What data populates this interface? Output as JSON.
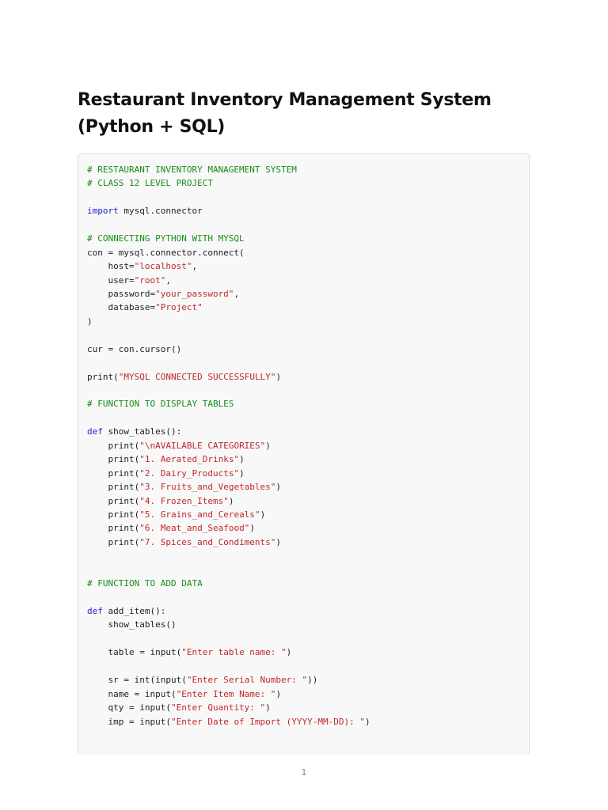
{
  "document": {
    "title_line1": "Restaurant Inventory Management System",
    "title_line2": "(Python + SQL)",
    "page_number": "1"
  },
  "colors": {
    "comment": "#1a8c1a",
    "keyword": "#2222dd",
    "string": "#c0282a",
    "plain": "#222222"
  },
  "code_lines": [
    [
      {
        "t": "cm",
        "v": "# RESTAURANT INVENTORY MANAGEMENT SYSTEM"
      }
    ],
    [
      {
        "t": "cm",
        "v": "# CLASS 12 LEVEL PROJECT"
      }
    ],
    [],
    [
      {
        "t": "kw",
        "v": "import"
      },
      {
        "t": "pl",
        "v": " mysql.connector"
      }
    ],
    [],
    [
      {
        "t": "cm",
        "v": "# CONNECTING PYTHON WITH MYSQL"
      }
    ],
    [
      {
        "t": "pl",
        "v": "con = mysql.connector.connect("
      }
    ],
    [
      {
        "t": "pl",
        "v": "    host="
      },
      {
        "t": "st",
        "v": "\"localhost\""
      },
      {
        "t": "pl",
        "v": ","
      }
    ],
    [
      {
        "t": "pl",
        "v": "    user="
      },
      {
        "t": "st",
        "v": "\"root\""
      },
      {
        "t": "pl",
        "v": ","
      }
    ],
    [
      {
        "t": "pl",
        "v": "    password="
      },
      {
        "t": "st",
        "v": "\"your_password\""
      },
      {
        "t": "pl",
        "v": ","
      }
    ],
    [
      {
        "t": "pl",
        "v": "    database="
      },
      {
        "t": "st",
        "v": "\"Project\""
      }
    ],
    [
      {
        "t": "pl",
        "v": ")"
      }
    ],
    [],
    [
      {
        "t": "pl",
        "v": "cur = con.cursor()"
      }
    ],
    [],
    [
      {
        "t": "pl",
        "v": "print("
      },
      {
        "t": "st",
        "v": "\"MYSQL CONNECTED SUCCESSFULLY\""
      },
      {
        "t": "pl",
        "v": ")"
      }
    ],
    [],
    [
      {
        "t": "cm",
        "v": "# FUNCTION TO DISPLAY TABLES"
      }
    ],
    [],
    [
      {
        "t": "kw",
        "v": "def"
      },
      {
        "t": "pl",
        "v": " show_tables():"
      }
    ],
    [
      {
        "t": "pl",
        "v": "    print("
      },
      {
        "t": "st",
        "v": "\"\\nAVAILABLE CATEGORIES\""
      },
      {
        "t": "pl",
        "v": ")"
      }
    ],
    [
      {
        "t": "pl",
        "v": "    print("
      },
      {
        "t": "st",
        "v": "\"1. Aerated_Drinks\""
      },
      {
        "t": "pl",
        "v": ")"
      }
    ],
    [
      {
        "t": "pl",
        "v": "    print("
      },
      {
        "t": "st",
        "v": "\"2. Dairy_Products\""
      },
      {
        "t": "pl",
        "v": ")"
      }
    ],
    [
      {
        "t": "pl",
        "v": "    print("
      },
      {
        "t": "st",
        "v": "\"3. Fruits_and_Vegetables\""
      },
      {
        "t": "pl",
        "v": ")"
      }
    ],
    [
      {
        "t": "pl",
        "v": "    print("
      },
      {
        "t": "st",
        "v": "\"4. Frozen_Items\""
      },
      {
        "t": "pl",
        "v": ")"
      }
    ],
    [
      {
        "t": "pl",
        "v": "    print("
      },
      {
        "t": "st",
        "v": "\"5. Grains_and_Cereals\""
      },
      {
        "t": "pl",
        "v": ")"
      }
    ],
    [
      {
        "t": "pl",
        "v": "    print("
      },
      {
        "t": "st",
        "v": "\"6. Meat_and_Seafood\""
      },
      {
        "t": "pl",
        "v": ")"
      }
    ],
    [
      {
        "t": "pl",
        "v": "    print("
      },
      {
        "t": "st",
        "v": "\"7. Spices_and_Condiments\""
      },
      {
        "t": "pl",
        "v": ")"
      }
    ],
    [],
    [],
    [
      {
        "t": "cm",
        "v": "# FUNCTION TO ADD DATA"
      }
    ],
    [],
    [
      {
        "t": "kw",
        "v": "def"
      },
      {
        "t": "pl",
        "v": " add_item():"
      }
    ],
    [
      {
        "t": "pl",
        "v": "    show_tables()"
      }
    ],
    [],
    [
      {
        "t": "pl",
        "v": "    table = input("
      },
      {
        "t": "st",
        "v": "\"Enter table name: \""
      },
      {
        "t": "pl",
        "v": ")"
      }
    ],
    [],
    [
      {
        "t": "pl",
        "v": "    sr = int(input("
      },
      {
        "t": "st",
        "v": "\"Enter Serial Number: \""
      },
      {
        "t": "pl",
        "v": "))"
      }
    ],
    [
      {
        "t": "pl",
        "v": "    name = input("
      },
      {
        "t": "st",
        "v": "\"Enter Item Name: \""
      },
      {
        "t": "pl",
        "v": ")"
      }
    ],
    [
      {
        "t": "pl",
        "v": "    qty = input("
      },
      {
        "t": "st",
        "v": "\"Enter Quantity: \""
      },
      {
        "t": "pl",
        "v": ")"
      }
    ],
    [
      {
        "t": "pl",
        "v": "    imp = input("
      },
      {
        "t": "st",
        "v": "\"Enter Date of Import (YYYY-MM-DD): \""
      },
      {
        "t": "pl",
        "v": ")"
      }
    ]
  ]
}
